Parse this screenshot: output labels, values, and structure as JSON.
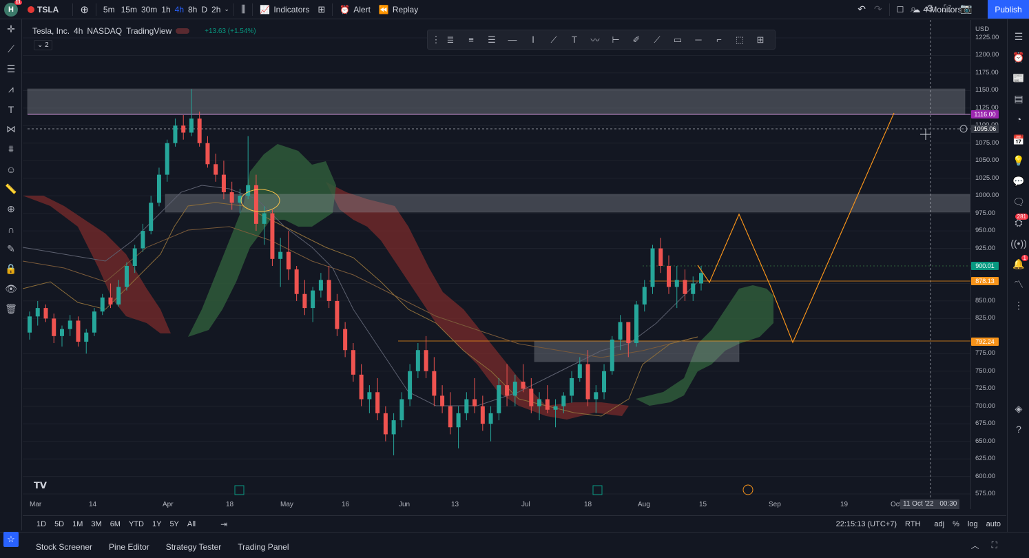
{
  "topbar": {
    "avatar_letter": "H",
    "avatar_badge": "11",
    "symbol": "TSLA",
    "intervals": [
      "5m",
      "15m",
      "30m",
      "1h",
      "4h",
      "8h",
      "D",
      "2h"
    ],
    "active_interval": "4h",
    "indicators_label": "Indicators",
    "alert_label": "Alert",
    "replay_label": "Replay",
    "monitors_label": "4 Monitors",
    "publish_label": "Publish"
  },
  "legend": {
    "company": "Tesla, Inc.",
    "interval": "4h",
    "exchange": "NASDAQ",
    "source": "TradingView",
    "change": "+13.63 (+1.54%)",
    "indicator_count": "2"
  },
  "price_axis": {
    "currency": "USD",
    "labels": [
      "1225.00",
      "1200.00",
      "1175.00",
      "1150.00",
      "1125.00",
      "1100.00",
      "1075.00",
      "1050.00",
      "1025.00",
      "1000.00",
      "975.00",
      "950.00",
      "925.00",
      "875.00",
      "850.00",
      "825.00",
      "775.00",
      "750.00",
      "725.00",
      "700.00",
      "675.00",
      "650.00",
      "625.00",
      "600.00",
      "575.00"
    ],
    "tags": [
      {
        "value": "1116.00",
        "color": "#9c27b0"
      },
      {
        "value": "1095.06",
        "color": "#363a45"
      },
      {
        "value": "900.01",
        "color": "#089981"
      },
      {
        "value": "878.13",
        "color": "#f7931a"
      },
      {
        "value": "792.24",
        "color": "#f7931a"
      }
    ]
  },
  "time_axis": {
    "labels": [
      "Mar",
      "14",
      "Apr",
      "18",
      "May",
      "16",
      "Jun",
      "13",
      "Jul",
      "18",
      "Aug",
      "15",
      "Sep",
      "19",
      "Oct"
    ],
    "cursor_date": "11 Oct '22",
    "cursor_time": "00:30"
  },
  "range_bar": {
    "ranges": [
      "1D",
      "5D",
      "1M",
      "3M",
      "6M",
      "YTD",
      "1Y",
      "5Y",
      "All"
    ],
    "clock": "22:15:13 (UTC+7)",
    "session": "RTH",
    "adj": "adj",
    "percent": "%",
    "log": "log",
    "auto": "auto"
  },
  "bottom_tabs": [
    "Stock Screener",
    "Pine Editor",
    "Strategy Tester",
    "Trading Panel"
  ],
  "right_badges": {
    "ideas": "281",
    "notifications": "1"
  },
  "chart_data": {
    "type": "candlestick",
    "ylim": [
      575,
      1225
    ],
    "candles": [
      [
        1,
        805,
        835,
        795,
        828
      ],
      [
        2,
        828,
        850,
        815,
        840
      ],
      [
        3,
        840,
        845,
        820,
        825
      ],
      [
        4,
        825,
        832,
        790,
        800
      ],
      [
        5,
        800,
        815,
        785,
        810
      ],
      [
        6,
        810,
        830,
        800,
        822
      ],
      [
        7,
        822,
        828,
        785,
        792
      ],
      [
        8,
        792,
        810,
        775,
        805
      ],
      [
        9,
        805,
        840,
        800,
        835
      ],
      [
        10,
        835,
        860,
        830,
        855
      ],
      [
        11,
        855,
        875,
        840,
        845
      ],
      [
        12,
        845,
        880,
        842,
        870
      ],
      [
        13,
        870,
        905,
        865,
        900
      ],
      [
        14,
        900,
        930,
        890,
        925
      ],
      [
        15,
        925,
        960,
        920,
        950
      ],
      [
        16,
        950,
        1000,
        945,
        990
      ],
      [
        17,
        990,
        1040,
        985,
        1030
      ],
      [
        18,
        1030,
        1080,
        1020,
        1075
      ],
      [
        19,
        1075,
        1110,
        1070,
        1100
      ],
      [
        20,
        1100,
        1115,
        1080,
        1090
      ],
      [
        21,
        1090,
        1152,
        1085,
        1110
      ],
      [
        22,
        1110,
        1120,
        1070,
        1075
      ],
      [
        23,
        1075,
        1085,
        1040,
        1045
      ],
      [
        24,
        1045,
        1060,
        1020,
        1030
      ],
      [
        25,
        1030,
        1050,
        995,
        1005
      ],
      [
        26,
        1005,
        1020,
        980,
        990
      ],
      [
        27,
        990,
        1010,
        975,
        1000
      ],
      [
        28,
        1000,
        1085,
        995,
        1015
      ],
      [
        29,
        1015,
        1030,
        950,
        960
      ],
      [
        30,
        960,
        985,
        930,
        975
      ],
      [
        31,
        975,
        980,
        900,
        910
      ],
      [
        32,
        910,
        940,
        870,
        920
      ],
      [
        33,
        920,
        950,
        880,
        895
      ],
      [
        34,
        895,
        900,
        850,
        860
      ],
      [
        35,
        860,
        880,
        830,
        840
      ],
      [
        36,
        840,
        870,
        820,
        865
      ],
      [
        37,
        865,
        890,
        855,
        880
      ],
      [
        38,
        880,
        900,
        840,
        850
      ],
      [
        39,
        850,
        860,
        800,
        810
      ],
      [
        40,
        810,
        820,
        770,
        780
      ],
      [
        41,
        780,
        790,
        735,
        745
      ],
      [
        42,
        745,
        760,
        700,
        710
      ],
      [
        43,
        710,
        730,
        690,
        720
      ],
      [
        44,
        720,
        740,
        680,
        690
      ],
      [
        45,
        690,
        700,
        650,
        660
      ],
      [
        46,
        660,
        690,
        630,
        680
      ],
      [
        47,
        680,
        720,
        670,
        710
      ],
      [
        48,
        710,
        760,
        700,
        750
      ],
      [
        49,
        750,
        790,
        740,
        780
      ],
      [
        50,
        780,
        800,
        740,
        750
      ],
      [
        51,
        750,
        770,
        700,
        715
      ],
      [
        52,
        715,
        730,
        690,
        700
      ],
      [
        53,
        700,
        720,
        660,
        670
      ],
      [
        54,
        670,
        700,
        640,
        690
      ],
      [
        55,
        690,
        720,
        680,
        710
      ],
      [
        56,
        710,
        740,
        690,
        700
      ],
      [
        57,
        700,
        715,
        665,
        675
      ],
      [
        58,
        675,
        700,
        650,
        690
      ],
      [
        59,
        690,
        740,
        680,
        730
      ],
      [
        60,
        730,
        760,
        700,
        715
      ],
      [
        61,
        715,
        745,
        700,
        735
      ],
      [
        62,
        735,
        760,
        720,
        725
      ],
      [
        63,
        725,
        740,
        690,
        700
      ],
      [
        64,
        700,
        720,
        680,
        710
      ],
      [
        65,
        710,
        730,
        690,
        695
      ],
      [
        66,
        695,
        710,
        670,
        700
      ],
      [
        67,
        700,
        720,
        690,
        715
      ],
      [
        68,
        715,
        750,
        705,
        740
      ],
      [
        69,
        740,
        770,
        735,
        760
      ],
      [
        70,
        760,
        780,
        700,
        710
      ],
      [
        71,
        710,
        730,
        690,
        720
      ],
      [
        72,
        720,
        760,
        710,
        750
      ],
      [
        73,
        750,
        800,
        745,
        795
      ],
      [
        74,
        795,
        830,
        780,
        820
      ],
      [
        75,
        820,
        810,
        770,
        790
      ],
      [
        76,
        790,
        850,
        785,
        845
      ],
      [
        77,
        845,
        880,
        835,
        870
      ],
      [
        78,
        870,
        930,
        860,
        925
      ],
      [
        79,
        925,
        940,
        890,
        900
      ],
      [
        80,
        900,
        915,
        860,
        870
      ],
      [
        81,
        870,
        900,
        840,
        880
      ],
      [
        82,
        880,
        895,
        850,
        860
      ],
      [
        83,
        860,
        885,
        850,
        875
      ],
      [
        84,
        875,
        900,
        865,
        890
      ]
    ]
  }
}
